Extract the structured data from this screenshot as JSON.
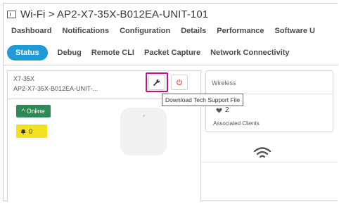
{
  "window": {
    "breadcrumb": "Wi-Fi > AP2-X7-35X-B012EA-UNIT-101"
  },
  "nav": [
    "Dashboard",
    "Notifications",
    "Configuration",
    "Details",
    "Performance",
    "Software U"
  ],
  "tabs": [
    {
      "label": "Status",
      "active": true
    },
    {
      "label": "Debug",
      "active": false
    },
    {
      "label": "Remote CLI",
      "active": false
    },
    {
      "label": "Packet Capture",
      "active": false
    },
    {
      "label": "Network Connectivity",
      "active": false
    }
  ],
  "ap": {
    "model": "X7-35X",
    "name": "AP2-X7-35X-B012EA-UNIT-...",
    "status": "Online",
    "alarm_count": "0",
    "tool_icon": "wrench-icon",
    "reboot_icon": "power-icon"
  },
  "wireless": {
    "title": "Wireless",
    "clients_count": "2",
    "clients_label": "Associated Clients"
  },
  "tooltip": "Download Tech Support File",
  "colors": {
    "accent": "#1e9bd7",
    "online": "#2d8a55",
    "alarm": "#f4e11e",
    "highlight": "#b5168e"
  }
}
